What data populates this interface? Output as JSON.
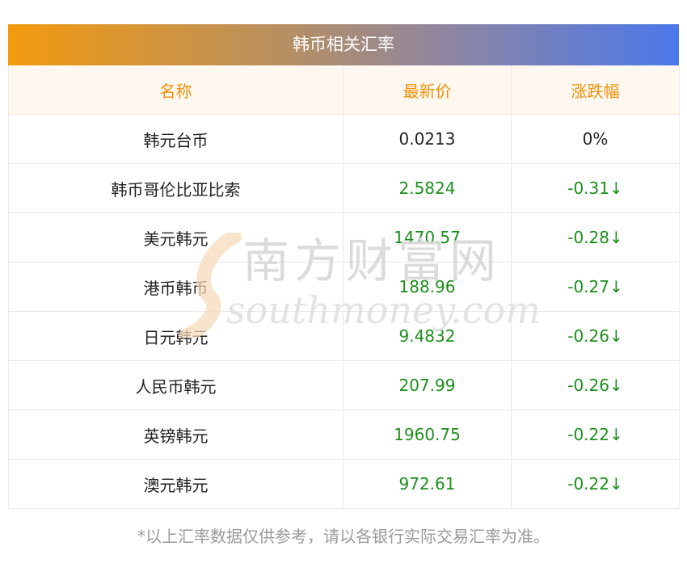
{
  "title": "韩币相关汇率",
  "headers": [
    "名称",
    "最新价",
    "涨跌幅"
  ],
  "rows": [
    {
      "name": "韩元台币",
      "price": "0.0213",
      "change": "0%",
      "dir": "none"
    },
    {
      "name": "韩币哥伦比亚比索",
      "price": "2.5824",
      "change": "-0.31↓",
      "dir": "down"
    },
    {
      "name": "美元韩元",
      "price": "1470.57",
      "change": "-0.28↓",
      "dir": "down"
    },
    {
      "name": "港币韩币",
      "price": "188.96",
      "change": "-0.27↓",
      "dir": "down"
    },
    {
      "name": "日元韩元",
      "price": "9.4832",
      "change": "-0.26↓",
      "dir": "down"
    },
    {
      "name": "人民币韩元",
      "price": "207.99",
      "change": "-0.26↓",
      "dir": "down"
    },
    {
      "name": "英镑韩元",
      "price": "1960.75",
      "change": "-0.22↓",
      "dir": "down"
    },
    {
      "name": "澳元韩元",
      "price": "972.61",
      "change": "-0.22↓",
      "dir": "down"
    }
  ],
  "note": "*以上汇率数据仅供参考，请以各银行实际交易汇率为准。",
  "watermark": {
    "cn": "南方财富网",
    "en": "southmoney.com"
  },
  "colors": {
    "header_text": "#f0900a",
    "down": "#1c8f1c",
    "gradient_start": "#f39a0f",
    "gradient_end": "#4b78ea"
  }
}
